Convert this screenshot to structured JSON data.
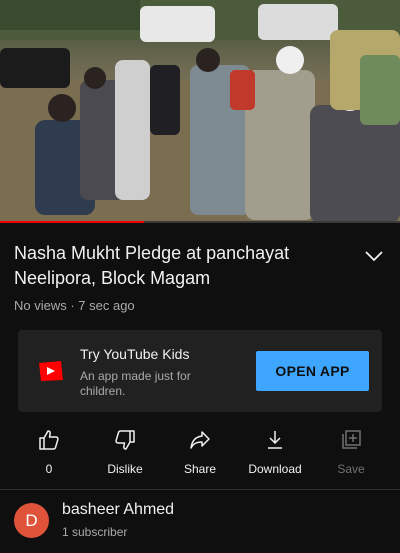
{
  "video": {
    "progress_fraction": 0.36
  },
  "title": "Nasha Mukht Pledge at panchayat Neelipora, Block Magam",
  "meta": "No views · 7 sec ago",
  "kids_banner": {
    "title": "Try YouTube Kids",
    "subtitle": "An app made just for children.",
    "button": "OPEN APP"
  },
  "actions": {
    "like_count": "0",
    "dislike": "Dislike",
    "share": "Share",
    "download": "Download",
    "save": "Save"
  },
  "channel": {
    "avatar_letter": "D",
    "name": "basheer Ahmed",
    "subscribers": "1 subscriber"
  },
  "colors": {
    "accent_red": "#ff0000",
    "button_blue": "#3ea6ff",
    "avatar": "#e0533b"
  }
}
